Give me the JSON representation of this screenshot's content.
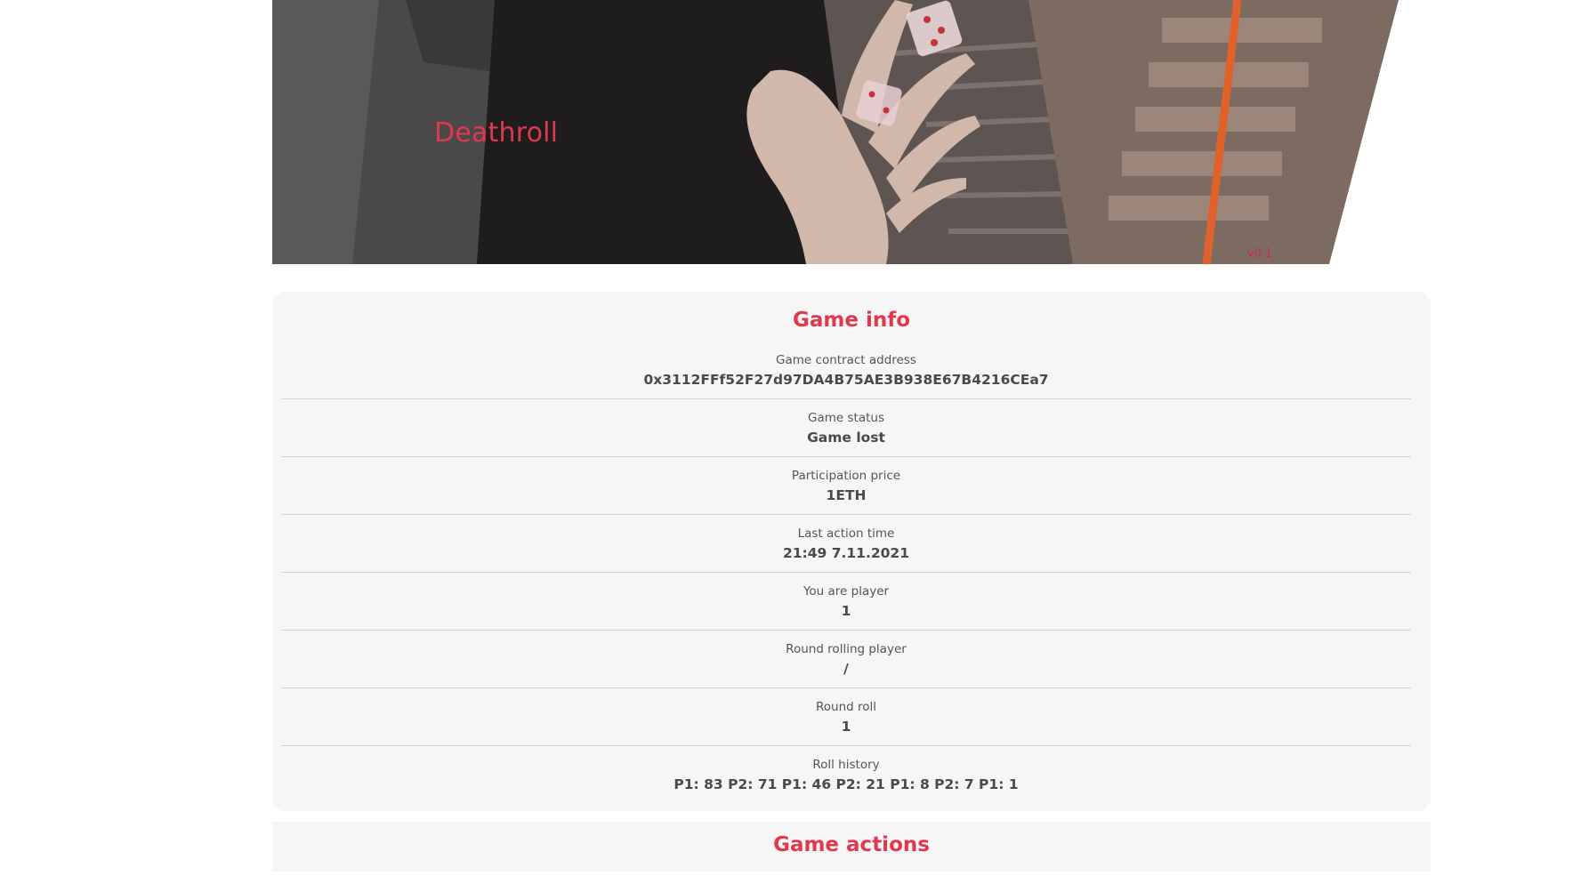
{
  "hero": {
    "title": "Deathroll",
    "version": "v0.1"
  },
  "game_info": {
    "heading": "Game info",
    "rows": [
      {
        "label": "Game contract address",
        "value": "0x3112FFf52F27d97DA4B75AE3B938E67B4216CEa7"
      },
      {
        "label": "Game status",
        "value": "Game lost"
      },
      {
        "label": "Participation price",
        "value": "1ETH"
      },
      {
        "label": "Last action time",
        "value": "21:49 7.11.2021"
      },
      {
        "label": "You are player",
        "value": "1"
      },
      {
        "label": "Round rolling player",
        "value": "/"
      },
      {
        "label": "Round roll",
        "value": "1"
      },
      {
        "label": "Roll history",
        "value": "P1: 83 P2: 71 P1: 46 P2: 21 P1: 8 P2: 7 P1: 1"
      }
    ]
  },
  "game_actions": {
    "heading": "Game actions"
  },
  "colors": {
    "accent": "#e0394f",
    "card_bg": "#f6f6f6",
    "divider": "#d4d4d4",
    "text_label": "#555555",
    "text_value": "#4a4a4a"
  }
}
